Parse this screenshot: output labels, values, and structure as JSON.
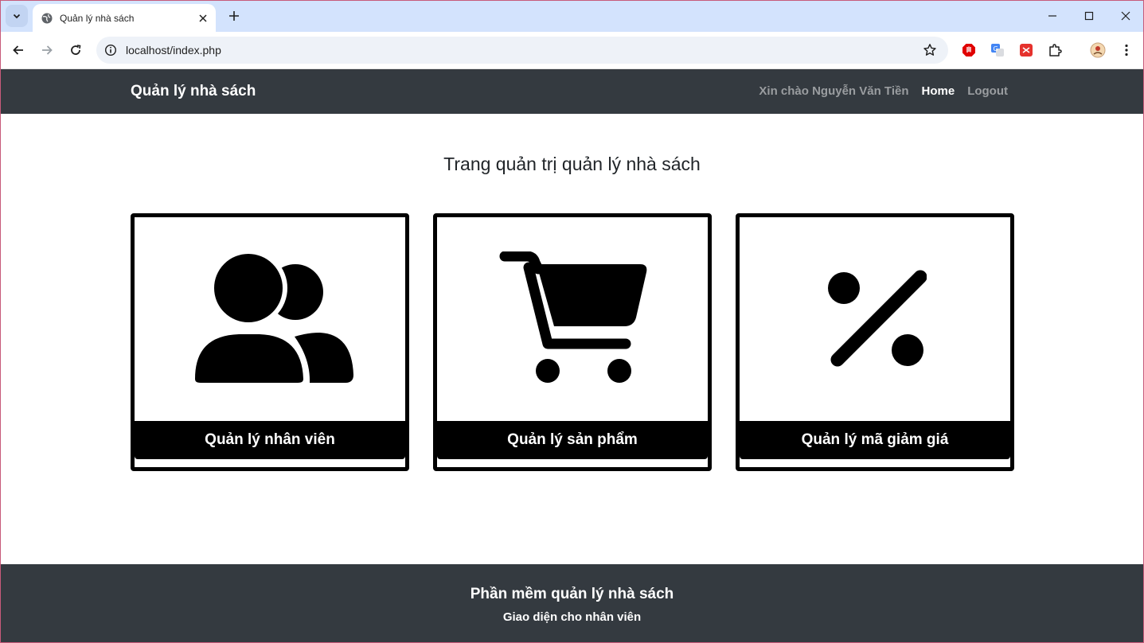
{
  "browser": {
    "tab_title": "Quản lý nhà sách",
    "url": "localhost/index.php"
  },
  "header": {
    "brand": "Quản lý nhà sách",
    "greeting": "Xin chào Nguyễn Văn Tiền",
    "home_label": "Home",
    "logout_label": "Logout"
  },
  "main": {
    "title": "Trang quản trị quản lý nhà sách",
    "cards": [
      {
        "label": "Quản lý nhân viên",
        "icon": "users-icon"
      },
      {
        "label": "Quản lý sản phẩm",
        "icon": "cart-icon"
      },
      {
        "label": "Quản lý mã giảm giá",
        "icon": "percent-icon"
      }
    ]
  },
  "footer": {
    "title": "Phần mềm quản lý nhà sách",
    "subtitle": "Giao diện cho nhân viên"
  },
  "colors": {
    "header_bg": "#343a40",
    "nav_muted": "#9a9da0",
    "card_border": "#000000",
    "tabbar_bg": "#d3e3fd"
  }
}
